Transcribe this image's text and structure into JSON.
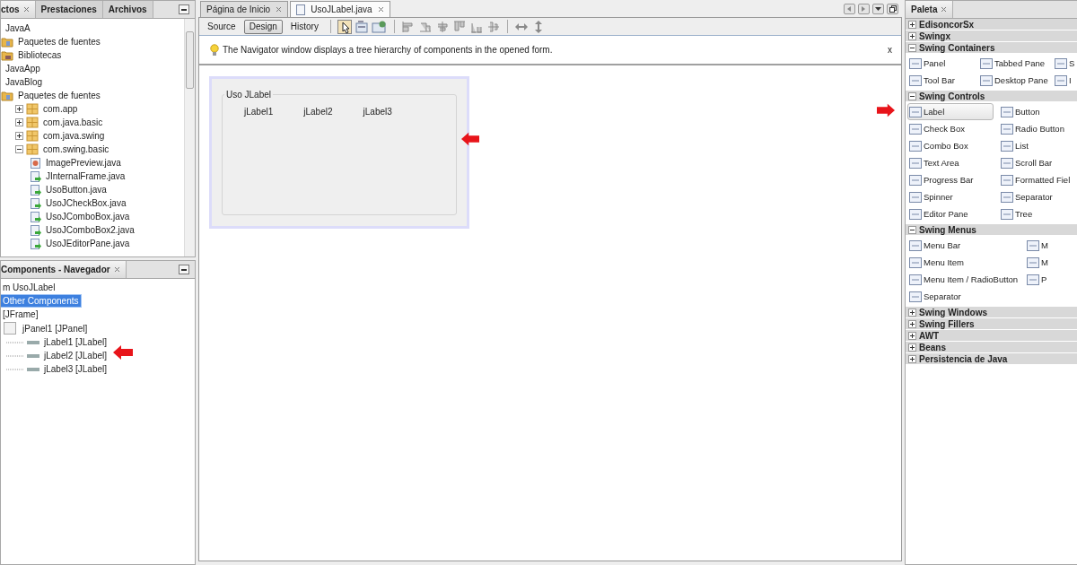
{
  "projects_panel": {
    "tabs": [
      {
        "label": "ctos",
        "selected": true
      },
      {
        "label": "Prestaciones",
        "selected": false
      },
      {
        "label": "Archivos",
        "selected": false
      }
    ],
    "tree": [
      {
        "label": "JavaA",
        "children": [
          {
            "label": "Paquetes de fuentes",
            "kind": "folder"
          },
          {
            "label": "Bibliotecas",
            "kind": "library"
          }
        ]
      },
      {
        "label": "JavaApp"
      },
      {
        "label": "JavaBlog",
        "children": [
          {
            "label": "Paquetes de fuentes",
            "kind": "folder",
            "children": [
              {
                "label": "com.app",
                "kind": "package",
                "expanded": false
              },
              {
                "label": "com.java.basic",
                "kind": "package",
                "expanded": false
              },
              {
                "label": "com.java.swing",
                "kind": "package",
                "expanded": false
              },
              {
                "label": "com.swing.basic",
                "kind": "package",
                "expanded": true,
                "children": [
                  {
                    "label": "ImagePreview.java",
                    "kind": "image-file"
                  },
                  {
                    "label": "JInternalFrame.java",
                    "kind": "file"
                  },
                  {
                    "label": "UsoButton.java",
                    "kind": "file"
                  },
                  {
                    "label": "UsoJCheckBox.java",
                    "kind": "file"
                  },
                  {
                    "label": "UsoJComboBox.java",
                    "kind": "file"
                  },
                  {
                    "label": "UsoJComboBox2.java",
                    "kind": "file"
                  },
                  {
                    "label": "UsoJEditorPane.java",
                    "kind": "file"
                  }
                ]
              }
            ]
          }
        ]
      }
    ]
  },
  "navigator": {
    "title": "Components - Navegador",
    "tree": [
      {
        "label": "m UsoJLabel",
        "selected": false
      },
      {
        "label": "Other Components",
        "selected": true
      },
      {
        "label": "[JFrame]",
        "selected": false,
        "children": [
          {
            "label": "jPanel1 [JPanel]",
            "kind": "panel",
            "selected": false,
            "children": [
              {
                "label": "jLabel1 [JLabel]",
                "kind": "label",
                "selected": false
              },
              {
                "label": "jLabel2 [JLabel]",
                "kind": "label",
                "selected": false
              },
              {
                "label": "jLabel3 [JLabel]",
                "kind": "label",
                "selected": false
              }
            ]
          }
        ]
      }
    ]
  },
  "editor": {
    "tabs": [
      {
        "label": "Página de Inicio",
        "selected": false
      },
      {
        "label": "UsoJLabel.java",
        "selected": true
      }
    ],
    "views": [
      {
        "label": "Source",
        "selected": false
      },
      {
        "label": "Design",
        "selected": true
      },
      {
        "label": "History",
        "selected": false
      }
    ],
    "hint": "The Navigator window displays a tree hierarchy of components in the opened form.",
    "hint_close": "x",
    "form": {
      "border_title": "Uso JLabel",
      "labels": [
        "jLabel1",
        "jLabel2",
        "jLabel3"
      ]
    }
  },
  "palette": {
    "title": "Paleta",
    "categories": [
      {
        "name": "EdisoncorSx",
        "expanded": false
      },
      {
        "name": "Swingx",
        "expanded": false
      },
      {
        "name": "Swing Containers",
        "expanded": true,
        "rows": [
          [
            {
              "label": "Panel",
              "selected": false
            },
            {
              "label": "Tabbed Pane",
              "selected": false
            },
            {
              "label": "S",
              "selected": false
            }
          ],
          [
            {
              "label": "Tool Bar",
              "selected": false
            },
            {
              "label": "Desktop Pane",
              "selected": false
            },
            {
              "label": "I",
              "selected": false
            }
          ]
        ]
      },
      {
        "name": "Swing Controls",
        "expanded": true,
        "rows": [
          [
            {
              "label": "Label",
              "selected": true
            },
            {
              "label": "Button",
              "selected": false
            }
          ],
          [
            {
              "label": "Check Box",
              "selected": false
            },
            {
              "label": "Radio Button",
              "selected": false
            }
          ],
          [
            {
              "label": "Combo Box",
              "selected": false
            },
            {
              "label": "List",
              "selected": false
            }
          ],
          [
            {
              "label": "Text Area",
              "selected": false
            },
            {
              "label": "Scroll Bar",
              "selected": false
            }
          ],
          [
            {
              "label": "Progress Bar",
              "selected": false
            },
            {
              "label": "Formatted Fiel",
              "selected": false
            }
          ],
          [
            {
              "label": "Spinner",
              "selected": false
            },
            {
              "label": "Separator",
              "selected": false
            }
          ],
          [
            {
              "label": "Editor Pane",
              "selected": false
            },
            {
              "label": "Tree",
              "selected": false
            }
          ]
        ]
      },
      {
        "name": "Swing Menus",
        "expanded": true,
        "rows": [
          [
            {
              "label": "Menu Bar",
              "selected": false
            },
            {
              "label": "M",
              "selected": false
            }
          ],
          [
            {
              "label": "Menu Item",
              "selected": false
            },
            {
              "label": "M",
              "selected": false
            }
          ],
          [
            {
              "label": "Menu Item / RadioButton",
              "selected": false
            },
            {
              "label": "P",
              "selected": false
            }
          ],
          [
            {
              "label": "Separator",
              "selected": false
            }
          ]
        ]
      },
      {
        "name": "Swing Windows",
        "expanded": false
      },
      {
        "name": "Swing Fillers",
        "expanded": false
      },
      {
        "name": "AWT",
        "expanded": false
      },
      {
        "name": "Beans",
        "expanded": false
      },
      {
        "name": "Persistencia de Java",
        "expanded": false
      }
    ]
  }
}
